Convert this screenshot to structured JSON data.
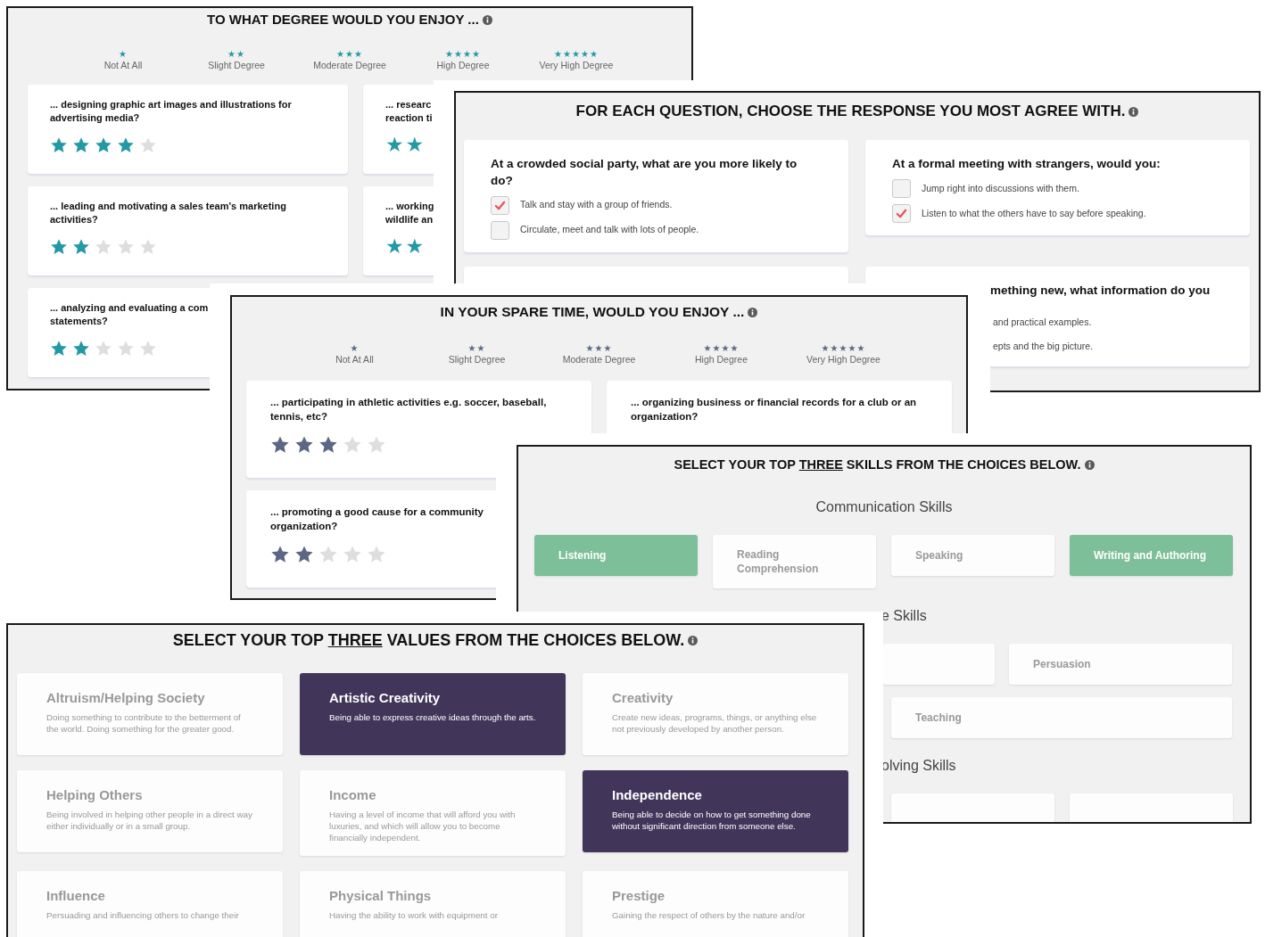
{
  "panels": [
    {
      "kind": "rating",
      "title": "TO WHAT DEGREE WOULD YOU ENJOY ...",
      "color": "#2399a6",
      "scale": [
        {
          "icon": "★",
          "label": "Not At All"
        },
        {
          "icon": "★★",
          "label": "Slight Degree"
        },
        {
          "icon": "★★★",
          "label": "Moderate Degree"
        },
        {
          "icon": "★★★★",
          "label": "High Degree"
        },
        {
          "icon": "★★★★★",
          "label": "Very High Degree"
        }
      ],
      "questions": [
        {
          "text": "... designing graphic art images and illustrations for\nadvertising media?",
          "stars": 4
        },
        {
          "text": "... researc\nreaction ti",
          "icon": "★★"
        },
        {
          "text": "... leading and motivating a sales team's marketing\nactivities?",
          "stars": 2
        },
        {
          "text": "... working\nwildlife an",
          "icon": "★★"
        },
        {
          "text": "... analyzing and evaluating a com\nstatements?",
          "stars": 2
        }
      ]
    },
    {
      "kind": "choice",
      "title": "FOR EACH QUESTION, CHOOSE THE RESPONSE YOU MOST AGREE WITH.",
      "questions": [
        {
          "kind": "question",
          "text": "At a crowded social party, what are you more likely to\ndo?",
          "options": [
            {
              "text": "Talk and stay with a group of friends.",
              "checked": true
            },
            {
              "text": "Circulate, meet and talk with lots of people.",
              "checked": false
            }
          ]
        },
        {
          "kind": "question",
          "text": "At a formal meeting with strangers, would you:",
          "options": [
            {
              "text": "Jump right into discussions with them.",
              "checked": false
            },
            {
              "text": "Listen to what the others have to say before speaking.",
              "checked": true
            }
          ]
        },
        {
          "kind": "blank"
        },
        {
          "kind": "question",
          "text": "mething new, what information do you",
          "options": [
            {
              "text": "and practical examples."
            },
            {
              "text": "epts and the big picture."
            }
          ]
        }
      ]
    },
    {
      "kind": "rating",
      "title": "IN YOUR SPARE TIME, WOULD YOU ENJOY ...",
      "color": "#5b6785",
      "scale": [
        {
          "icon": "★",
          "label": "Not At All"
        },
        {
          "icon": "★★",
          "label": "Slight Degree"
        },
        {
          "icon": "★★★",
          "label": "Moderate Degree"
        },
        {
          "icon": "★★★★",
          "label": "High Degree"
        },
        {
          "icon": "★★★★★",
          "label": "Very High Degree"
        }
      ],
      "questions": [
        {
          "text": "... participating in athletic activities e.g. soccer, baseball,\ntennis, etc?",
          "stars": 3
        },
        {
          "text": "... organizing business or financial records for a club or an\norganization?"
        },
        {
          "text": "... promoting a good cause for a community\norganization?",
          "stars": 2
        }
      ]
    },
    {
      "kind": "skills",
      "title_before": "SELECT YOUR TOP",
      "title_underlined": "THREE",
      "title_after": "SKILLS FROM THE CHOICES BELOW.",
      "groups": [
        {
          "heading": "Communication Skills",
          "skills": [
            {
              "label": "Listening",
              "selected": true
            },
            {
              "label": "Reading Comprehension",
              "selected": false
            },
            {
              "label": "Speaking",
              "selected": false
            },
            {
              "label": "Writing and Authoring",
              "selected": true
            }
          ]
        },
        {
          "heading": "e Skills",
          "skills": [
            {
              "selected": false
            },
            {
              "label": "Persuasion",
              "selected": false
            },
            {
              "label": "Teaching",
              "selected": false
            }
          ]
        },
        {
          "heading": "olving Skills",
          "skills": [
            {
              "selected": false
            },
            {
              "selected": false
            }
          ]
        }
      ]
    },
    {
      "kind": "values",
      "title_before": "SELECT YOUR TOP",
      "title_underlined": "THREE",
      "title_after": "VALUES FROM THE CHOICES BELOW.",
      "values": [
        {
          "title": "Altruism/Helping Society",
          "description": "Doing something to contribute to the betterment of the world. Doing something for the greater good.",
          "selected": false
        },
        {
          "title": "Artistic Creativity",
          "description": "Being able to express creative ideas through the arts.",
          "selected": true
        },
        {
          "title": "Creativity",
          "description": "Create new ideas, programs, things, or anything else not previously developed by another person.",
          "selected": false
        },
        {
          "title": "Helping Others",
          "description": "Being involved in helping other people in a direct way either individually or in a small group.",
          "selected": false
        },
        {
          "title": "Income",
          "description": "Having a level of income that will afford you with luxuries, and which will allow you to become financially independent.",
          "selected": false
        },
        {
          "title": "Independence",
          "description": "Being able to decide on how to get something done without significant direction from someone else.",
          "selected": true
        },
        {
          "title": "Influence",
          "description": "Persuading and influencing others to change their",
          "selected": false
        },
        {
          "title": "Physical Things",
          "description": "Having the ability to work with equipment or",
          "selected": false
        },
        {
          "title": "Prestige",
          "description": "Gaining the respect of others by the nature and/or",
          "selected": false
        }
      ]
    }
  ]
}
